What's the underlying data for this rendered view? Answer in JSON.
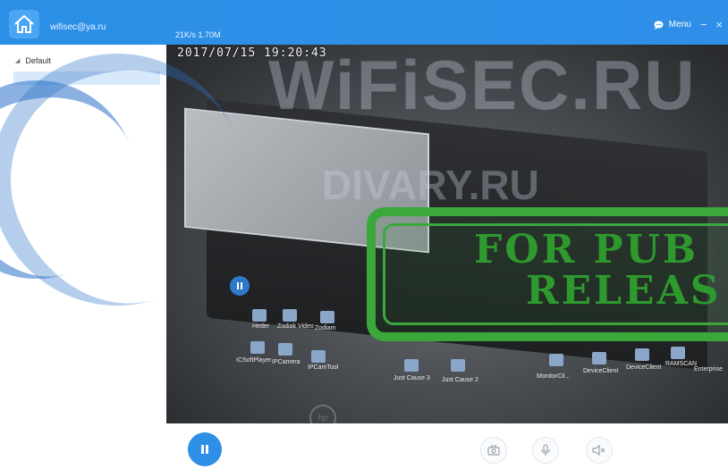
{
  "header": {
    "user_email": "wifisec@ya.ru",
    "speed": "21K/s 1.70M",
    "menu_label": "Menu",
    "minimize_symbol": "−",
    "close_symbol": "×"
  },
  "sidebar": {
    "groups": [
      {
        "label": "Default",
        "expanded": true
      }
    ]
  },
  "video": {
    "timestamp": "2017/07/15 19:20:43",
    "desktop_labels": [
      "Heder",
      "Zodiak Video",
      "Zodiam",
      "IPCamTool",
      "Just Cause 3",
      "Just Cause 2",
      "MonitorCli...",
      "DeviceClient",
      "RAMSCAN",
      "Enterprise",
      "DeviceClient",
      "IPCamera",
      "ICSoftPlayer"
    ],
    "watermarks": {
      "main": "WiFiSEC.RU",
      "secondary": "DIVARY.RU",
      "stamp_line1": "FOR PUB",
      "stamp_line2": "RELEAS"
    },
    "laptop_brand": "hp"
  },
  "controls": {
    "pause": "pause-icon",
    "snapshot": "camera-icon",
    "mic": "microphone-icon",
    "mute": "speaker-mute-icon"
  },
  "colors": {
    "accent": "#2d8fe6",
    "stamp": "#3aa83a",
    "selected_row": "#d7e9fb"
  }
}
